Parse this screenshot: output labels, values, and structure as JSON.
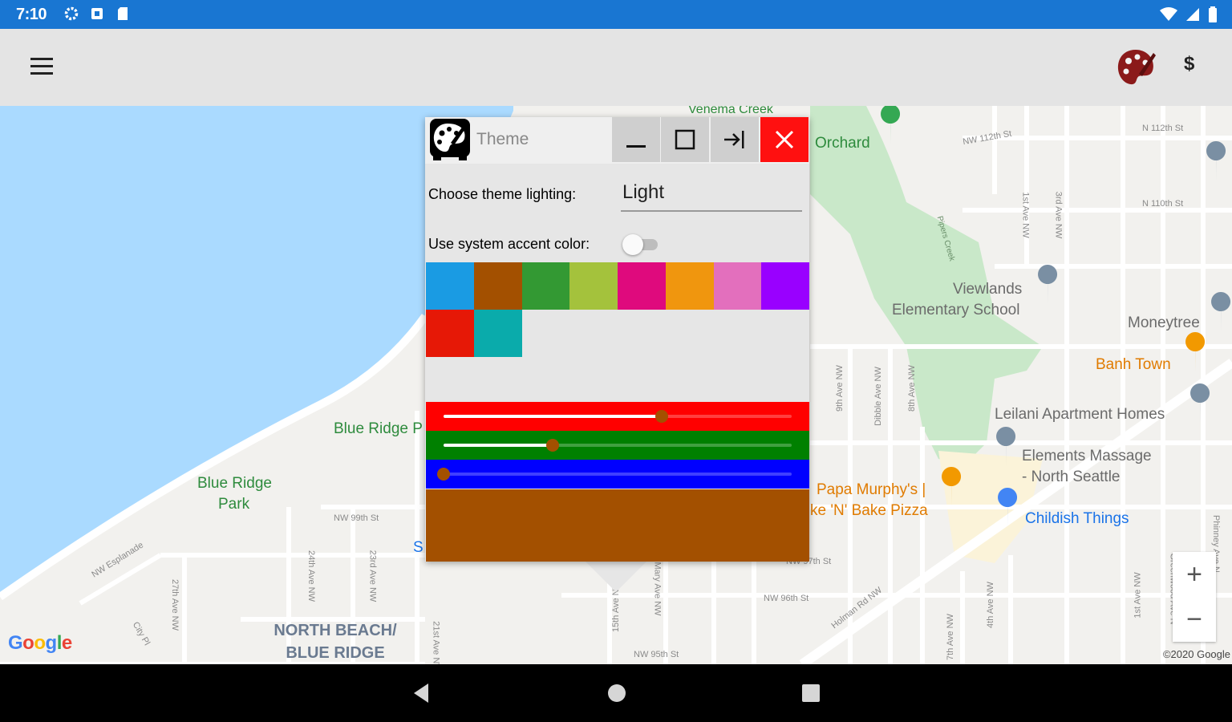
{
  "status_bar": {
    "time": "7:10",
    "left_icons": [
      "settings-icon",
      "app-notification-icon",
      "sd-card-icon"
    ],
    "right_icons": [
      "wifi-icon",
      "cell-signal-icon",
      "battery-icon"
    ],
    "color": "#1976d2"
  },
  "app_bar": {
    "menu_icon": "hamburger-menu-icon",
    "palette_icon": "theme-palette-icon",
    "dollar_label": "$"
  },
  "map": {
    "labels": {
      "creek": "Venema Creek",
      "orchard": "Orchard",
      "viewlands_1": "Viewlands",
      "viewlands_2": "Elementary School",
      "moneytree": "Moneytree",
      "banh_town": "Banh Town",
      "leilani": "Leilani Apartment Homes",
      "elements_1": "Elements Massage",
      "elements_2": "- North Seattle",
      "papa_1": "Papa Murphy's |",
      "papa_2": "ke 'N' Bake Pizza",
      "childish": "Childish Things",
      "blue_ridge_p": "Blue Ridge P",
      "brp_1": "Blue Ridge",
      "brp_2": "Park",
      "north_beach_1": "NORTH BEACH/",
      "north_beach_2": "BLUE RIDGE",
      "piper_creek": "Pipers Creek",
      "s_letter": "S",
      "nw_112": "NW 112th St",
      "n_112": "N 112th St",
      "n_110": "N 110th St",
      "nw_99": "NW 99th St",
      "nw_97": "NW 97th St",
      "nw_96": "NW 96th St",
      "nw_95": "NW 95th St",
      "nw_esplanade": "NW Esplanade",
      "holman": "Holman Rd NW",
      "ave_24": "24th Ave NW",
      "ave_23": "23rd Ave NW",
      "ave_27": "27th Ave NW",
      "ave_21": "21st Ave NW",
      "ave_15": "15th Ave NW",
      "ave_9": "9th Ave NW",
      "ave_8": "8th Ave NW",
      "dibble": "Dibble Ave NW",
      "ave_7": "7th Ave NW",
      "ave_4": "4th Ave NW",
      "ave_1": "1st Ave NW",
      "ave_3": "3rd Ave NW",
      "ave_1n": "1st Ave NW",
      "mary": "Mary Ave NW",
      "city_pl": "City Pl",
      "greenwood_n": "Greenwood Ave N",
      "phinney": "Phinney Ave N"
    },
    "google_logo": [
      "G",
      "o",
      "o",
      "g",
      "l",
      "e"
    ],
    "google_colors": [
      "#4285f4",
      "#ea4335",
      "#fbbc05",
      "#4285f4",
      "#34a853",
      "#ea4335"
    ],
    "copyright": "©2020 Google",
    "zoom_in": "+",
    "zoom_out": "−",
    "water_color": "#aadaff",
    "park_color": "#c9e8c9"
  },
  "dialog": {
    "title": "Theme",
    "icon": "theme-palette-icon",
    "buttons": {
      "minimize": "minimize-icon",
      "maximize": "maximize-icon",
      "pin": "pin-to-side-icon",
      "close": "close-icon"
    },
    "lighting_label": "Choose theme lighting:",
    "lighting_value": "Light",
    "accent_label": "Use system accent color:",
    "accent_toggle_on": false,
    "swatches": [
      "#1a9be3",
      "#a35000",
      "#339933",
      "#a4c23c",
      "#df0a7d",
      "#f0960e",
      "#e36fbd",
      "#9900ff",
      "#e61806",
      "#0aabab"
    ],
    "sliders": [
      {
        "channel": "red",
        "color": "#ff0000",
        "value": 0.627
      },
      {
        "channel": "green",
        "color": "#008000",
        "value": 0.314
      },
      {
        "channel": "blue",
        "color": "#0000ff",
        "value": 0.0
      }
    ],
    "preview_color": "#a35000"
  },
  "nav_bar": {
    "back": "back-icon",
    "home": "home-icon",
    "recents": "recents-icon"
  }
}
